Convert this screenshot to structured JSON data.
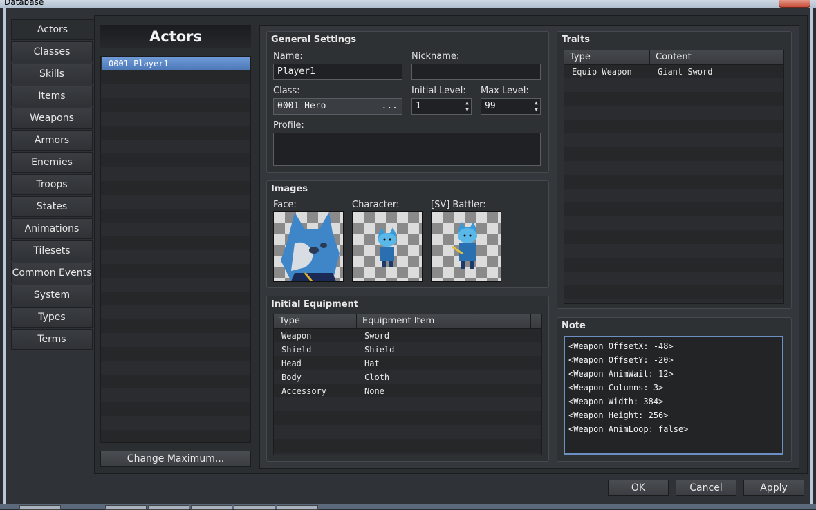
{
  "window": {
    "title": "Database"
  },
  "tabs": [
    "Actors",
    "Classes",
    "Skills",
    "Items",
    "Weapons",
    "Armors",
    "Enemies",
    "Troops",
    "States",
    "Animations",
    "Tilesets",
    "Common Events",
    "System",
    "Types",
    "Terms"
  ],
  "actors": {
    "header": "Actors",
    "list": [
      "0001 Player1"
    ],
    "change_max_label": "Change Maximum..."
  },
  "general": {
    "title": "General Settings",
    "name_label": "Name:",
    "name_value": "Player1",
    "nickname_label": "Nickname:",
    "nickname_value": "",
    "class_label": "Class:",
    "class_value": "0001 Hero",
    "class_button": "...",
    "initial_level_label": "Initial Level:",
    "initial_level_value": "1",
    "max_level_label": "Max Level:",
    "max_level_value": "99",
    "profile_label": "Profile:",
    "profile_value": ""
  },
  "images": {
    "title": "Images",
    "face_label": "Face:",
    "character_label": "Character:",
    "battler_label": "[SV] Battler:"
  },
  "equipment": {
    "title": "Initial Equipment",
    "col_type": "Type",
    "col_item": "Equipment Item",
    "rows": [
      {
        "type": "Weapon",
        "item": "Sword"
      },
      {
        "type": "Shield",
        "item": "Shield"
      },
      {
        "type": "Head",
        "item": "Hat"
      },
      {
        "type": "Body",
        "item": "Cloth"
      },
      {
        "type": "Accessory",
        "item": "None"
      }
    ]
  },
  "traits": {
    "title": "Traits",
    "col_type": "Type",
    "col_content": "Content",
    "rows": [
      {
        "type": "Equip Weapon",
        "content": "Giant Sword"
      }
    ]
  },
  "note": {
    "title": "Note",
    "lines": [
      "<Weapon OffsetX: -48>",
      "<Weapon OffsetY: -20>",
      "<Weapon AnimWait: 12>",
      "<Weapon Columns: 3>",
      "<Weapon Width: 384>",
      "<Weapon Height: 256>",
      "<Weapon AnimLoop: false>"
    ]
  },
  "buttons": {
    "ok": "OK",
    "cancel": "Cancel",
    "apply": "Apply"
  },
  "colors": {
    "selection": "#5a86c6",
    "note_border": "#6c8fc4",
    "panel": "#2e3134"
  }
}
